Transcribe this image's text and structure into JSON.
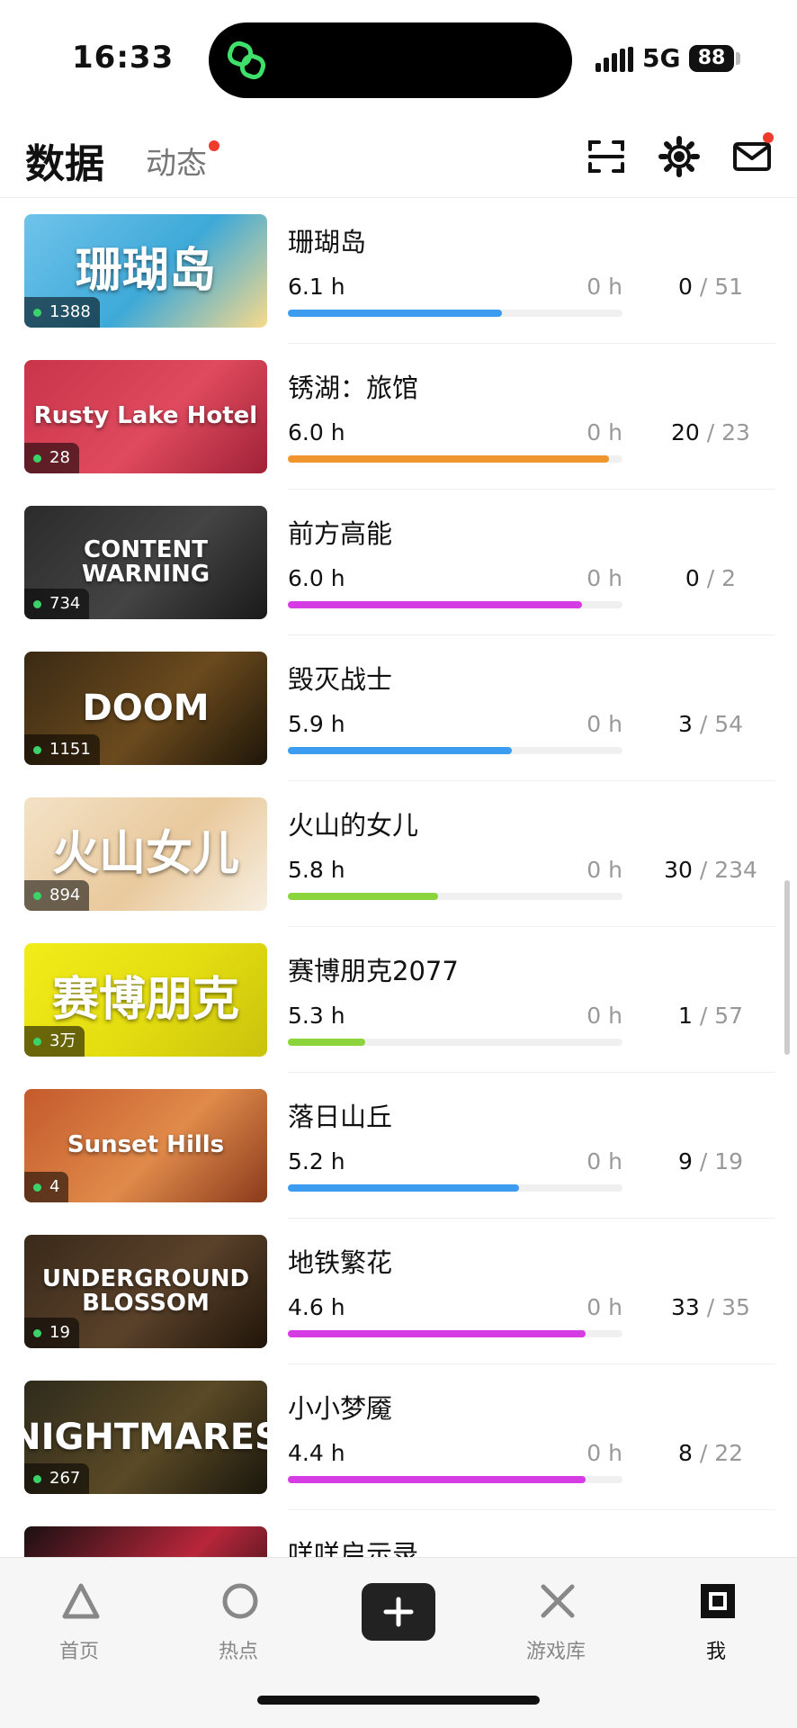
{
  "status": {
    "time": "16:33",
    "network": "5G",
    "battery": "88"
  },
  "header": {
    "title": "数据",
    "feed_tab": "动态"
  },
  "games": [
    {
      "name": "珊瑚岛",
      "art_text": "珊瑚岛",
      "art_colors": [
        "#6fc3ea",
        "#3ea9d8",
        "#f7d98b"
      ],
      "badge": "1388",
      "hours": "6.1 h",
      "recent": "0 h",
      "progress": 0.64,
      "bar_color": "#3b9cf0",
      "ach_done": "0",
      "ach_total": "/ 51"
    },
    {
      "name": "锈湖：旅馆",
      "art_text": "Rusty Lake Hotel",
      "art_colors": [
        "#c8344a",
        "#e04a5e",
        "#a02237"
      ],
      "badge": "28",
      "hours": "6.0 h",
      "recent": "0 h",
      "progress": 0.96,
      "bar_color": "#f0952e",
      "ach_done": "20",
      "ach_total": "/ 23"
    },
    {
      "name": "前方高能",
      "art_text": "CONTENT WARNING",
      "art_colors": [
        "#2b2b2b",
        "#444",
        "#1a1a1a"
      ],
      "badge": "734",
      "hours": "6.0 h",
      "recent": "0 h",
      "progress": 0.88,
      "bar_color": "#d63ce3",
      "ach_done": "0",
      "ach_total": "/ 2"
    },
    {
      "name": "毁灭战士",
      "art_text": "DOOM",
      "art_colors": [
        "#3a2a14",
        "#6b4a1d",
        "#1e1609"
      ],
      "badge": "1151",
      "hours": "5.9 h",
      "recent": "0 h",
      "progress": 0.67,
      "bar_color": "#3b9cf0",
      "ach_done": "3",
      "ach_total": "/ 54"
    },
    {
      "name": "火山的女儿",
      "art_text": "火山女儿",
      "art_colors": [
        "#f3e2c6",
        "#e9c99d",
        "#f7efe0"
      ],
      "badge": "894",
      "hours": "5.8 h",
      "recent": "0 h",
      "progress": 0.45,
      "bar_color": "#8bd43c",
      "ach_done": "30",
      "ach_total": "/ 234"
    },
    {
      "name": "赛博朋克2077",
      "art_text": "赛博朋克",
      "art_colors": [
        "#f2ec1a",
        "#e3dc10",
        "#c9c20c"
      ],
      "badge": "3万",
      "hours": "5.3 h",
      "recent": "0 h",
      "progress": 0.23,
      "bar_color": "#8bd43c",
      "ach_done": "1",
      "ach_total": "/ 57"
    },
    {
      "name": "落日山丘",
      "art_text": "Sunset Hills",
      "art_colors": [
        "#c45a2c",
        "#e08a4a",
        "#8a3a1c"
      ],
      "badge": "4",
      "hours": "5.2 h",
      "recent": "0 h",
      "progress": 0.69,
      "bar_color": "#3b9cf0",
      "ach_done": "9",
      "ach_total": "/ 19"
    },
    {
      "name": "地铁繁花",
      "art_text": "UNDERGROUND BLOSSOM",
      "art_colors": [
        "#3a2a1a",
        "#5a412a",
        "#201509"
      ],
      "badge": "19",
      "hours": "4.6 h",
      "recent": "0 h",
      "progress": 0.89,
      "bar_color": "#d63ce3",
      "ach_done": "33",
      "ach_total": "/ 35"
    },
    {
      "name": "小小梦魇",
      "art_text": "NIGHTMARES",
      "art_colors": [
        "#2e2a1c",
        "#5a4a26",
        "#1a160c"
      ],
      "badge": "267",
      "hours": "4.4 h",
      "recent": "0 h",
      "progress": 0.89,
      "bar_color": "#d63ce3",
      "ach_done": "8",
      "ach_total": "/ 22"
    },
    {
      "name": "咩咩启示录",
      "art_text": "",
      "art_colors": [
        "#1a1012",
        "#b8263a",
        "#1a1012"
      ],
      "badge": "",
      "hours": "",
      "recent": "",
      "progress": 0,
      "bar_color": "#d63ce3",
      "ach_done": "",
      "ach_total": ""
    }
  ],
  "tabbar": {
    "home": "首页",
    "hot": "热点",
    "library": "游戏库",
    "me": "我"
  }
}
